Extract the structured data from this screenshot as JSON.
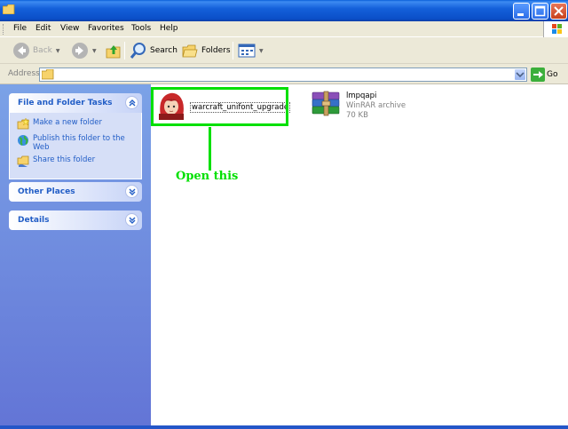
{
  "menu": [
    "File",
    "Edit",
    "View",
    "Favorites",
    "Tools",
    "Help"
  ],
  "toolbar": {
    "back": "Back",
    "search": "Search",
    "folders": "Folders"
  },
  "address": {
    "label": "Address",
    "go": "Go"
  },
  "tasks": {
    "file_folder": {
      "title": "File and Folder Tasks",
      "items": [
        "Make a new folder",
        "Publish this folder to the Web",
        "Share this folder"
      ]
    },
    "other_places": {
      "title": "Other Places"
    },
    "details": {
      "title": "Details"
    }
  },
  "files": [
    {
      "name": "warcraft_unifont_upgrade",
      "icon": "redhead-character-icon"
    },
    {
      "name": "lmpqapi",
      "type": "WinRAR archive",
      "size": "70 KB",
      "icon": "winrar-archive-icon"
    }
  ],
  "annotation": {
    "text": "Open this",
    "color": "#00E000"
  },
  "colors": {
    "titlebar": "#0B4FC8",
    "task_link": "#215DC6",
    "left_pane": "#7BA2E7"
  }
}
